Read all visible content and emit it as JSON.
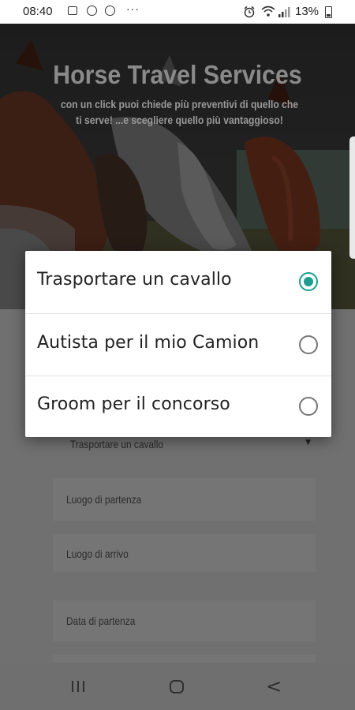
{
  "status_bar": {
    "time": "08:40",
    "battery_percent": "13%",
    "icons": [
      "image-icon",
      "sync-icon",
      "sync-alt-icon",
      "more-dots-icon",
      "alarm-icon",
      "wifi-icon",
      "signal-icon",
      "battery-icon"
    ]
  },
  "hero": {
    "title": "Horse Travel Services",
    "subtitle": "con un click puoi chiede più preventivi di quello che ti serve! ...e scegliere quello più vantaggioso!"
  },
  "dialog": {
    "options": [
      {
        "label": "Trasportare un cavallo",
        "selected": true
      },
      {
        "label": "Autista per il mio Camion",
        "selected": false
      },
      {
        "label": "Groom per il concorso",
        "selected": false
      }
    ],
    "accent_color": "#1b9e8f"
  },
  "form": {
    "service_select": {
      "value": "Trasportare un cavallo"
    },
    "departure_place": {
      "placeholder": "Luogo di partenza"
    },
    "arrival_place": {
      "placeholder": "Luogo di arrivo"
    },
    "departure_date": {
      "placeholder": "Data di partenza"
    }
  },
  "nav_bar": {
    "buttons": [
      "recents-icon",
      "home-icon",
      "back-icon"
    ],
    "back_glyph": "<"
  }
}
